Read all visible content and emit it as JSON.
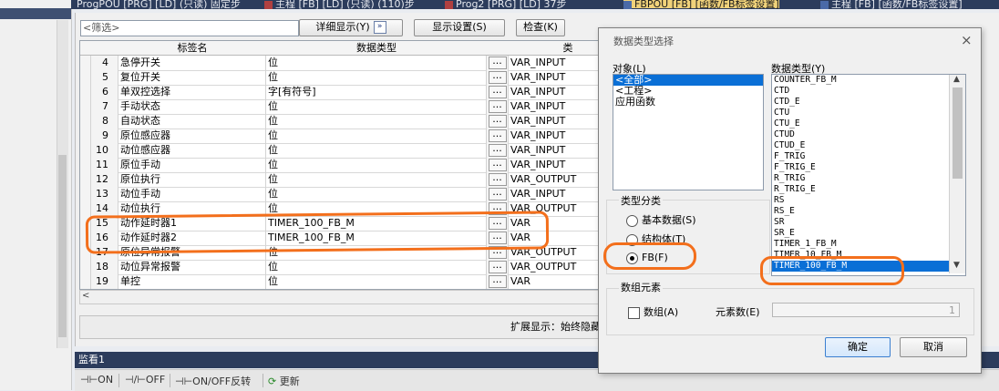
{
  "tabs": [
    {
      "label": "ProgPOU [PRG] [LD] (只读) 固定步"
    },
    {
      "label": "主程 [FB] [LD] (只读) (110)步"
    },
    {
      "label": "Prog2 [PRG] [LD] 37步"
    },
    {
      "label": "FBPOU [FB] [函数/FB标签设置]"
    },
    {
      "label": "主程 [FB] [函数/FB标签设置]"
    }
  ],
  "toolbar": {
    "filter_placeholder": "<筛选>",
    "detail_label": "详细显示(Y)",
    "detail_toggle": "»",
    "display_settings_label": "显示设置(S)",
    "check_label": "检查(K)"
  },
  "table": {
    "headers": {
      "name": "标签名",
      "type": "数据类型",
      "class": "类"
    },
    "rows": [
      {
        "num": "4",
        "name": "急停开关",
        "type": "位",
        "dots": "...",
        "class": "VAR_INPUT"
      },
      {
        "num": "5",
        "name": "复位开关",
        "type": "位",
        "dots": "...",
        "class": "VAR_INPUT"
      },
      {
        "num": "6",
        "name": "单双控选择",
        "type": "字[有符号]",
        "dots": "...",
        "class": "VAR_INPUT"
      },
      {
        "num": "7",
        "name": "手动状态",
        "type": "位",
        "dots": "...",
        "class": "VAR_INPUT"
      },
      {
        "num": "8",
        "name": "自动状态",
        "type": "位",
        "dots": "...",
        "class": "VAR_INPUT"
      },
      {
        "num": "9",
        "name": "原位感应器",
        "type": "位",
        "dots": "...",
        "class": "VAR_INPUT"
      },
      {
        "num": "10",
        "name": "动位感应器",
        "type": "位",
        "dots": "...",
        "class": "VAR_INPUT"
      },
      {
        "num": "11",
        "name": "原位手动",
        "type": "位",
        "dots": "...",
        "class": "VAR_INPUT"
      },
      {
        "num": "12",
        "name": "原位执行",
        "type": "位",
        "dots": "...",
        "class": "VAR_OUTPUT"
      },
      {
        "num": "13",
        "name": "动位手动",
        "type": "位",
        "dots": "...",
        "class": "VAR_INPUT"
      },
      {
        "num": "14",
        "name": "动位执行",
        "type": "位",
        "dots": "...",
        "class": "VAR_OUTPUT"
      },
      {
        "num": "15",
        "name": "动作延时器1",
        "type": "TIMER_100_FB_M",
        "dots": "...",
        "class": "VAR"
      },
      {
        "num": "16",
        "name": "动作延时器2",
        "type": "TIMER_100_FB_M",
        "dots": "...",
        "class": "VAR"
      },
      {
        "num": "17",
        "name": "原位异常报警",
        "type": "位",
        "dots": "...",
        "class": "VAR_OUTPUT"
      },
      {
        "num": "18",
        "name": "动位异常报警",
        "type": "位",
        "dots": "...",
        "class": "VAR_OUTPUT"
      },
      {
        "num": "19",
        "name": "单控",
        "type": "位",
        "dots": "...",
        "class": "VAR"
      }
    ]
  },
  "extension": {
    "label": "扩展显示：始终隐藏"
  },
  "watch": {
    "title": "监看1",
    "on_label": "ON",
    "off_label": "OFF",
    "toggle_label": "ON/OFF反转",
    "refresh_label": "更新"
  },
  "dialog": {
    "title": "数据类型选择",
    "close": "×",
    "object_label": "对象(L)",
    "objects": [
      "<全部>",
      "<工程>",
      "应用函数"
    ],
    "dtype_label": "数据类型(Y)",
    "dtypes": [
      "COUNTER_FB_M",
      "CTD",
      "CTD_E",
      "CTU",
      "CTU_E",
      "CTUD",
      "CTUD_E",
      "F_TRIG",
      "F_TRIG_E",
      "R_TRIG",
      "R_TRIG_E",
      "RS",
      "RS_E",
      "SR",
      "SR_E",
      "TIMER_1_FB_M",
      "TIMER_10_FB_M",
      "TIMER_100_FB_M"
    ],
    "type_group_label": "类型分类",
    "radio_basic": "基本数据(S)",
    "radio_struct": "结构体(T)",
    "radio_fb": "FB(F)",
    "array_group_label": "数组元素",
    "array_check": "数组(A)",
    "count_label": "元素数(E)",
    "count_value": "1",
    "ok_label": "确定",
    "cancel_label": "取消"
  },
  "colors": {
    "accent": "#0a6fd6",
    "annotation": "#f36f1c",
    "titlebar": "#2c3c5c"
  }
}
